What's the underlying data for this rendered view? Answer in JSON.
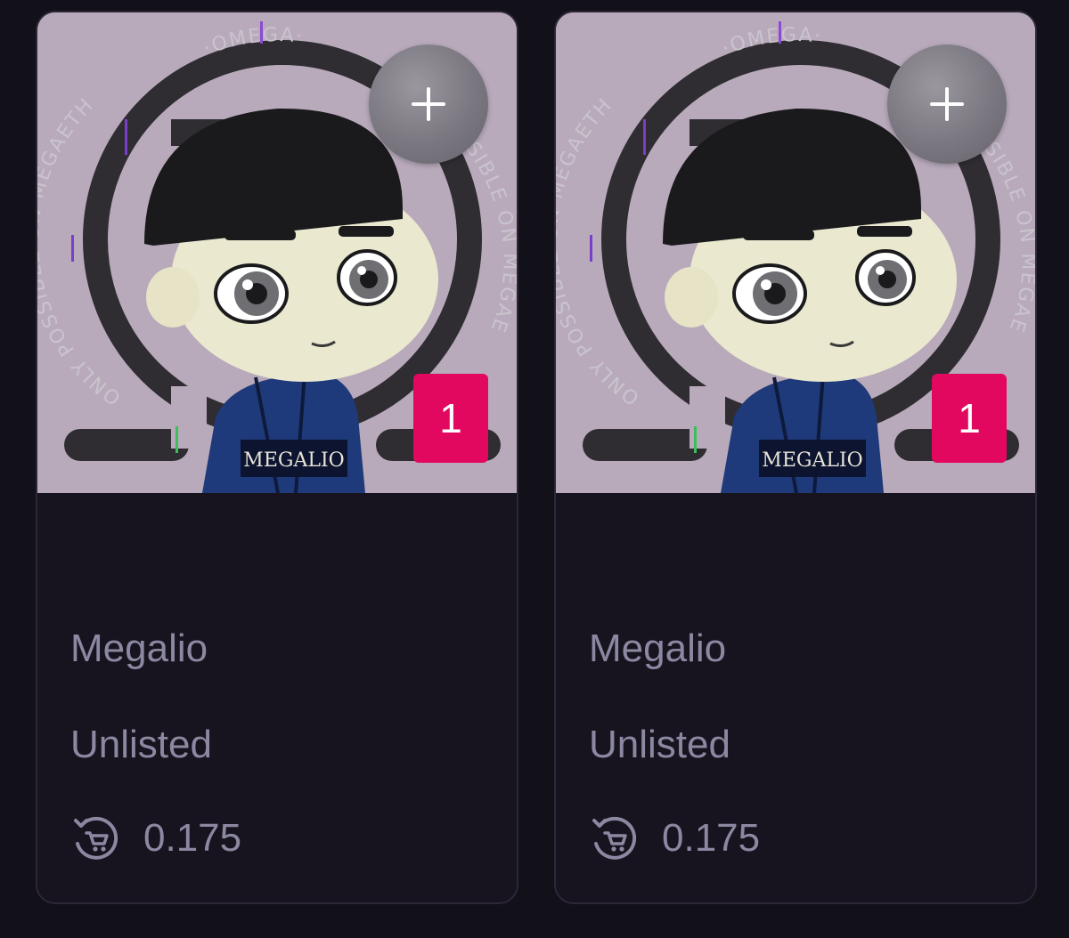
{
  "colors": {
    "page_background": "#121019",
    "card_background": "#17141f",
    "card_border": "#2c2838",
    "text_muted": "#8d88a2",
    "badge": "#e2085f",
    "add_button": "#7a7780"
  },
  "cards": [
    {
      "name": "Megalio",
      "status": "Unlisted",
      "price": "0.175",
      "quantity": "1",
      "add_icon": "plus-icon",
      "price_icon": "cart-refresh-icon",
      "artwork": {
        "description_icon": "character-artwork",
        "ring_text_left": "ONLY POSSIBLE ON MEGAETH",
        "ring_text_top": "·OMEGA·",
        "ring_text_right": "SSIBLE ON MEGAE",
        "jacket_text": "MEGALIO"
      }
    },
    {
      "name": "Megalio",
      "status": "Unlisted",
      "price": "0.175",
      "quantity": "1",
      "add_icon": "plus-icon",
      "price_icon": "cart-refresh-icon",
      "artwork": {
        "description_icon": "character-artwork",
        "ring_text_left": "ONLY POSSIBLE ON MEGAETH",
        "ring_text_top": "·OMEGA·",
        "ring_text_right": "SSIBLE ON MEGAE",
        "jacket_text": "MEGALIO"
      }
    }
  ]
}
